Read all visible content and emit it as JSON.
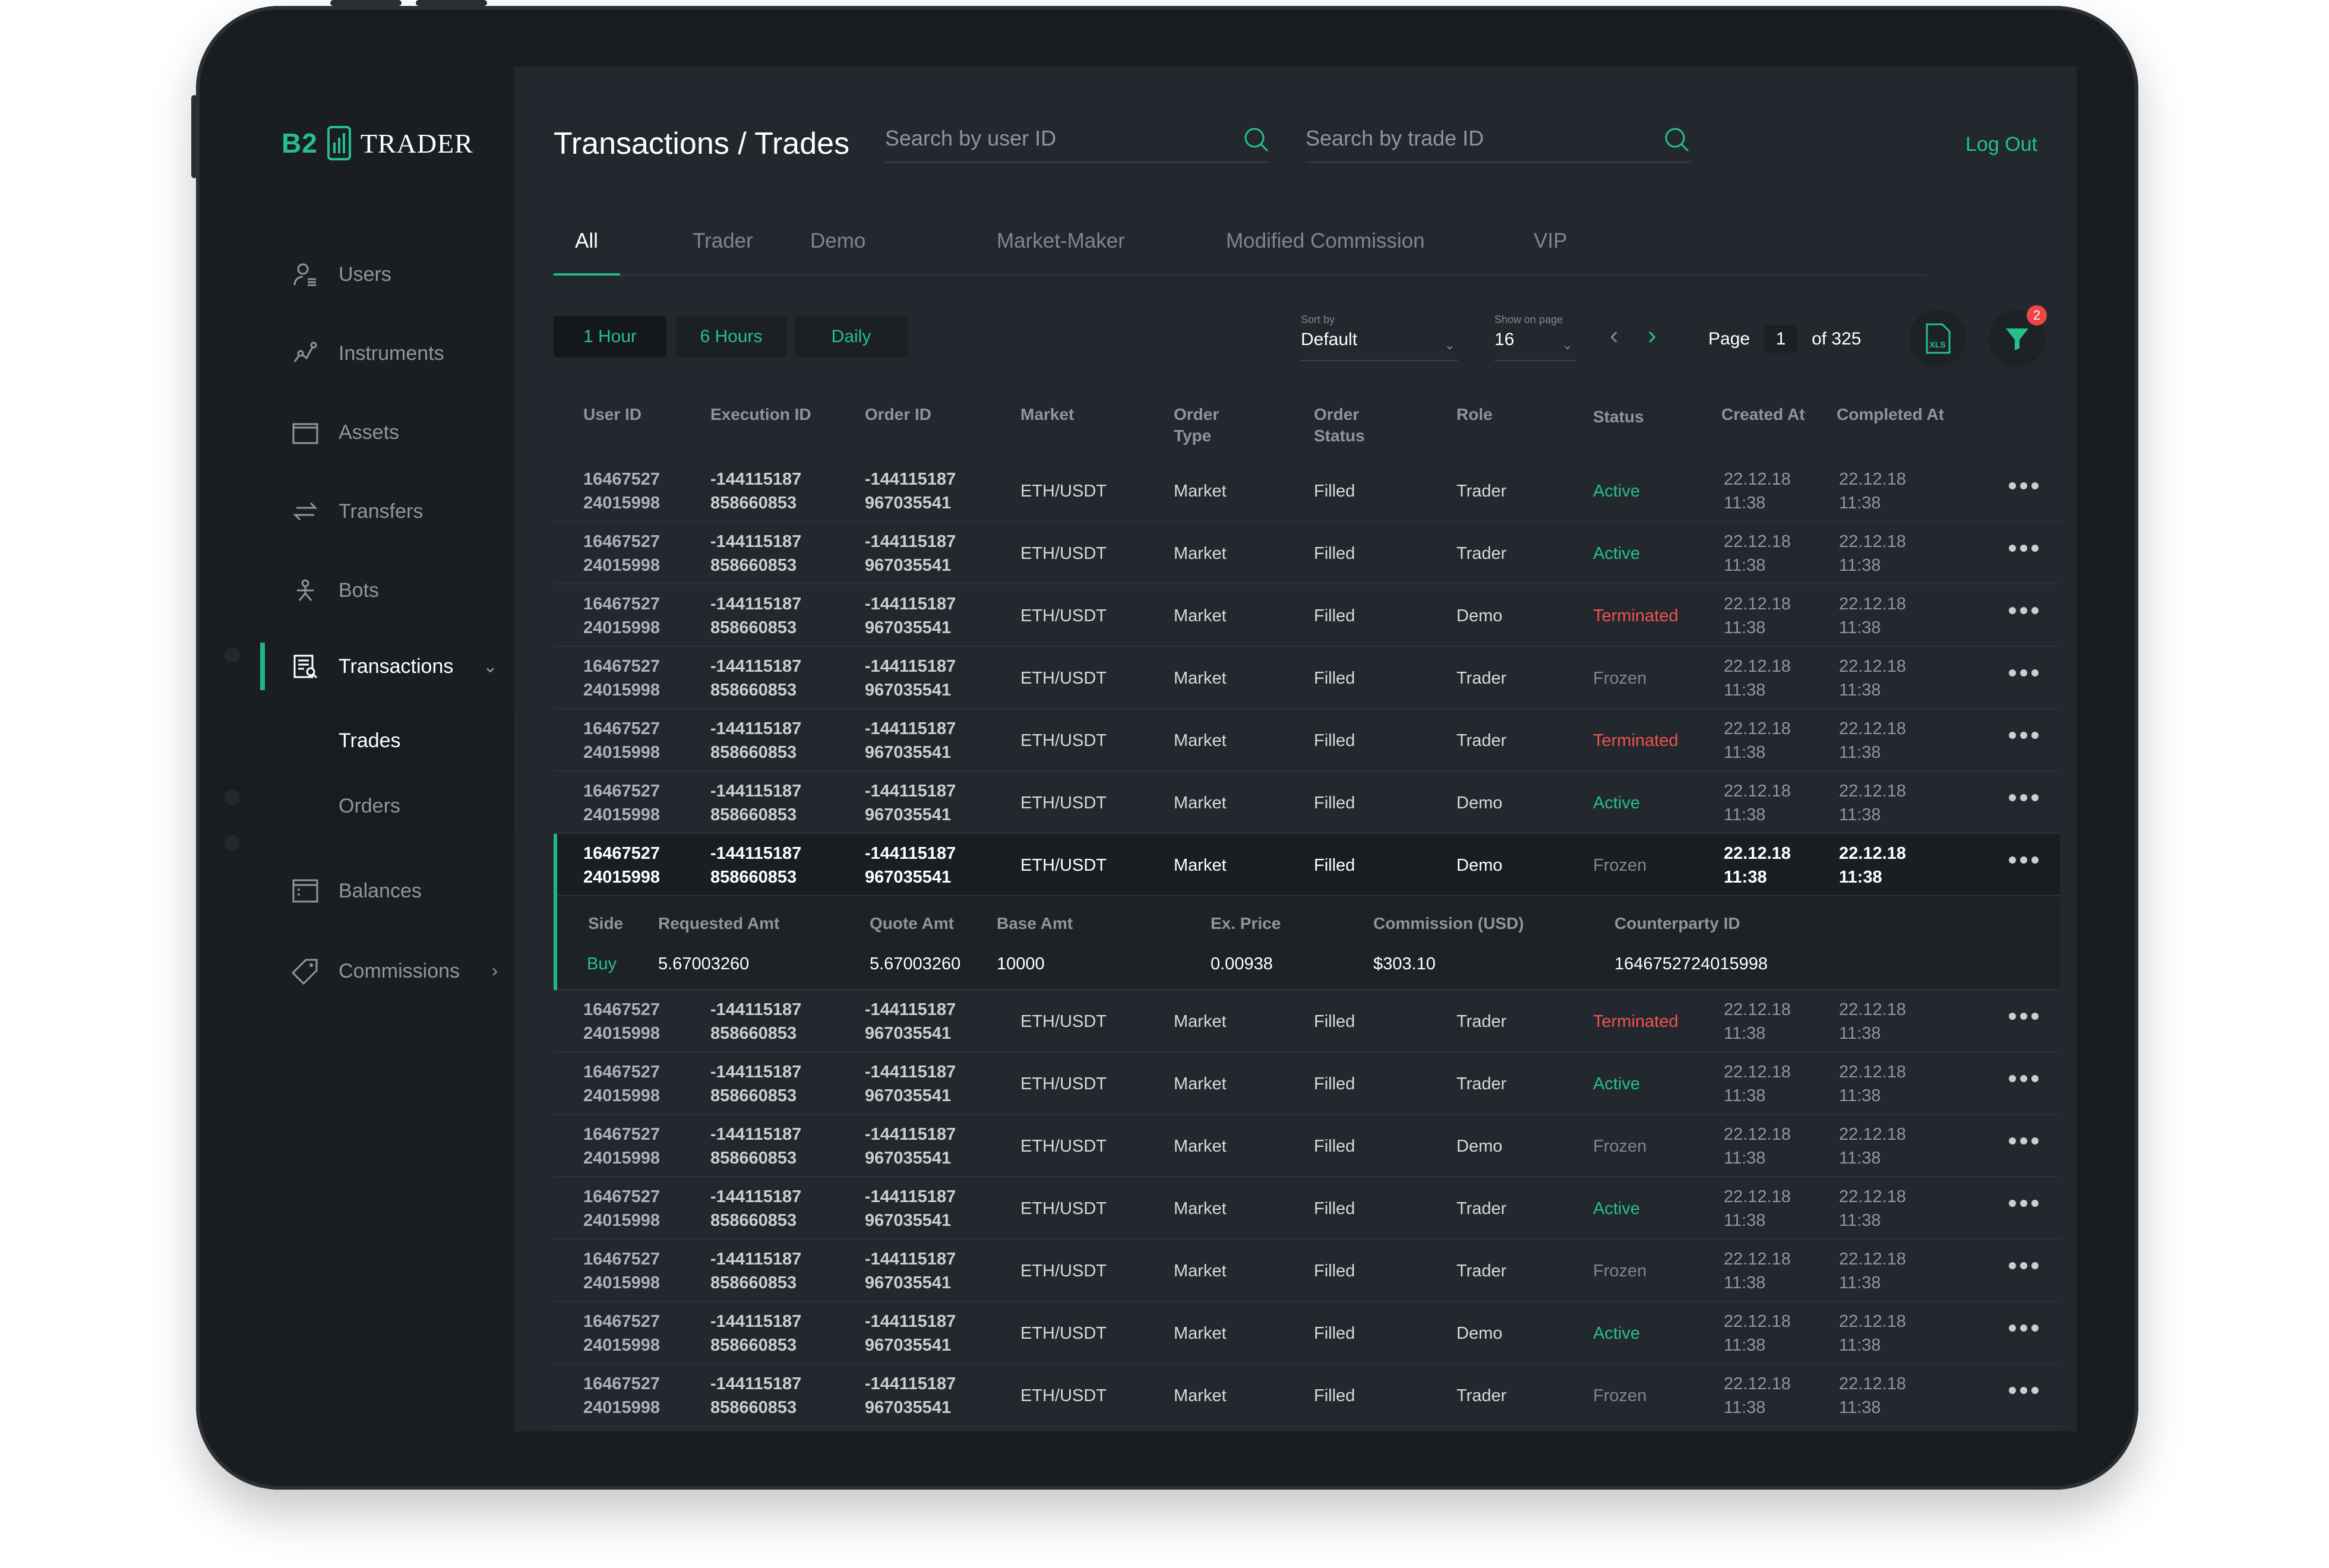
{
  "brand": {
    "b2": "B2",
    "name": "TRADER"
  },
  "header": {
    "title": "Transactions / Trades",
    "search_user_placeholder": "Search by user ID",
    "search_trade_placeholder": "Search by trade ID",
    "logout": "Log Out"
  },
  "sidebar": {
    "users": "Users",
    "instruments": "Instruments",
    "assets": "Assets",
    "transfers": "Transfers",
    "bots": "Bots",
    "transactions": "Transactions",
    "trades": "Trades",
    "orders": "Orders",
    "balances": "Balances",
    "commissions": "Commissions"
  },
  "tabs": [
    "All",
    "Trader",
    "Demo",
    "Market-Maker",
    "Modified Commission",
    "VIP"
  ],
  "toolbar": {
    "range_buttons": [
      "1 Hour",
      "6 Hours",
      "Daily"
    ],
    "sort_label": "Sort by",
    "sort_value": "Default",
    "show_label": "Show on page",
    "show_value": "16",
    "page_label": "Page",
    "page_value": "1",
    "page_total": "of 325",
    "xls_label": "XLS",
    "filter_count": "2"
  },
  "table": {
    "headers": [
      "User ID",
      "Execution ID",
      "Order ID",
      "Market",
      "Order Type",
      "Order Status",
      "Role",
      "Status",
      "Created At",
      "Completed At"
    ],
    "rows": [
      {
        "uid1": "16467527",
        "uid2": "24015998",
        "e1": "-144115187",
        "e2": "858660853",
        "o1": "-144115187",
        "o2": "967035541",
        "market": "ETH/USDT",
        "type": "Market",
        "ostatus": "Filled",
        "role": "Trader",
        "status": "Active",
        "cd": "22.12.18",
        "ct": "11:38",
        "fd": "22.12.18",
        "ft": "11:38"
      },
      {
        "uid1": "16467527",
        "uid2": "24015998",
        "e1": "-144115187",
        "e2": "858660853",
        "o1": "-144115187",
        "o2": "967035541",
        "market": "ETH/USDT",
        "type": "Market",
        "ostatus": "Filled",
        "role": "Trader",
        "status": "Active",
        "cd": "22.12.18",
        "ct": "11:38",
        "fd": "22.12.18",
        "ft": "11:38"
      },
      {
        "uid1": "16467527",
        "uid2": "24015998",
        "e1": "-144115187",
        "e2": "858660853",
        "o1": "-144115187",
        "o2": "967035541",
        "market": "ETH/USDT",
        "type": "Market",
        "ostatus": "Filled",
        "role": "Demo",
        "status": "Terminated",
        "cd": "22.12.18",
        "ct": "11:38",
        "fd": "22.12.18",
        "ft": "11:38"
      },
      {
        "uid1": "16467527",
        "uid2": "24015998",
        "e1": "-144115187",
        "e2": "858660853",
        "o1": "-144115187",
        "o2": "967035541",
        "market": "ETH/USDT",
        "type": "Market",
        "ostatus": "Filled",
        "role": "Trader",
        "status": "Frozen",
        "cd": "22.12.18",
        "ct": "11:38",
        "fd": "22.12.18",
        "ft": "11:38"
      },
      {
        "uid1": "16467527",
        "uid2": "24015998",
        "e1": "-144115187",
        "e2": "858660853",
        "o1": "-144115187",
        "o2": "967035541",
        "market": "ETH/USDT",
        "type": "Market",
        "ostatus": "Filled",
        "role": "Trader",
        "status": "Terminated",
        "cd": "22.12.18",
        "ct": "11:38",
        "fd": "22.12.18",
        "ft": "11:38"
      },
      {
        "uid1": "16467527",
        "uid2": "24015998",
        "e1": "-144115187",
        "e2": "858660853",
        "o1": "-144115187",
        "o2": "967035541",
        "market": "ETH/USDT",
        "type": "Market",
        "ostatus": "Filled",
        "role": "Demo",
        "status": "Active",
        "cd": "22.12.18",
        "ct": "11:38",
        "fd": "22.12.18",
        "ft": "11:38"
      },
      {
        "uid1": "16467527",
        "uid2": "24015998",
        "e1": "-144115187",
        "e2": "858660853",
        "o1": "-144115187",
        "o2": "967035541",
        "market": "ETH/USDT",
        "type": "Market",
        "ostatus": "Filled",
        "role": "Demo",
        "status": "Frozen",
        "cd": "22.12.18",
        "ct": "11:38",
        "fd": "22.12.18",
        "ft": "11:38",
        "selected": true
      },
      {
        "uid1": "16467527",
        "uid2": "24015998",
        "e1": "-144115187",
        "e2": "858660853",
        "o1": "-144115187",
        "o2": "967035541",
        "market": "ETH/USDT",
        "type": "Market",
        "ostatus": "Filled",
        "role": "Trader",
        "status": "Terminated",
        "cd": "22.12.18",
        "ct": "11:38",
        "fd": "22.12.18",
        "ft": "11:38"
      },
      {
        "uid1": "16467527",
        "uid2": "24015998",
        "e1": "-144115187",
        "e2": "858660853",
        "o1": "-144115187",
        "o2": "967035541",
        "market": "ETH/USDT",
        "type": "Market",
        "ostatus": "Filled",
        "role": "Trader",
        "status": "Active",
        "cd": "22.12.18",
        "ct": "11:38",
        "fd": "22.12.18",
        "ft": "11:38"
      },
      {
        "uid1": "16467527",
        "uid2": "24015998",
        "e1": "-144115187",
        "e2": "858660853",
        "o1": "-144115187",
        "o2": "967035541",
        "market": "ETH/USDT",
        "type": "Market",
        "ostatus": "Filled",
        "role": "Demo",
        "status": "Frozen",
        "cd": "22.12.18",
        "ct": "11:38",
        "fd": "22.12.18",
        "ft": "11:38"
      },
      {
        "uid1": "16467527",
        "uid2": "24015998",
        "e1": "-144115187",
        "e2": "858660853",
        "o1": "-144115187",
        "o2": "967035541",
        "market": "ETH/USDT",
        "type": "Market",
        "ostatus": "Filled",
        "role": "Trader",
        "status": "Active",
        "cd": "22.12.18",
        "ct": "11:38",
        "fd": "22.12.18",
        "ft": "11:38"
      },
      {
        "uid1": "16467527",
        "uid2": "24015998",
        "e1": "-144115187",
        "e2": "858660853",
        "o1": "-144115187",
        "o2": "967035541",
        "market": "ETH/USDT",
        "type": "Market",
        "ostatus": "Filled",
        "role": "Trader",
        "status": "Frozen",
        "cd": "22.12.18",
        "ct": "11:38",
        "fd": "22.12.18",
        "ft": "11:38"
      },
      {
        "uid1": "16467527",
        "uid2": "24015998",
        "e1": "-144115187",
        "e2": "858660853",
        "o1": "-144115187",
        "o2": "967035541",
        "market": "ETH/USDT",
        "type": "Market",
        "ostatus": "Filled",
        "role": "Demo",
        "status": "Active",
        "cd": "22.12.18",
        "ct": "11:38",
        "fd": "22.12.18",
        "ft": "11:38"
      },
      {
        "uid1": "16467527",
        "uid2": "24015998",
        "e1": "-144115187",
        "e2": "858660853",
        "o1": "-144115187",
        "o2": "967035541",
        "market": "ETH/USDT",
        "type": "Market",
        "ostatus": "Filled",
        "role": "Trader",
        "status": "Frozen",
        "cd": "22.12.18",
        "ct": "11:38",
        "fd": "22.12.18",
        "ft": "11:38"
      }
    ],
    "detail": {
      "headers": [
        "Side",
        "Requested Amt",
        "Quote Amt",
        "Base Amt",
        "Ex. Price",
        "Commission (USD)",
        "Counterparty ID"
      ],
      "values": [
        "Buy",
        "5.67003260",
        "5.67003260",
        "10000",
        "0.00938",
        "$303.10",
        "1646752724015998"
      ]
    }
  },
  "colors": {
    "accent": "#25c08a",
    "active": "#25c08a",
    "terminated": "#f0524f",
    "frozen": "#7f878e",
    "badge": "#f04545"
  }
}
